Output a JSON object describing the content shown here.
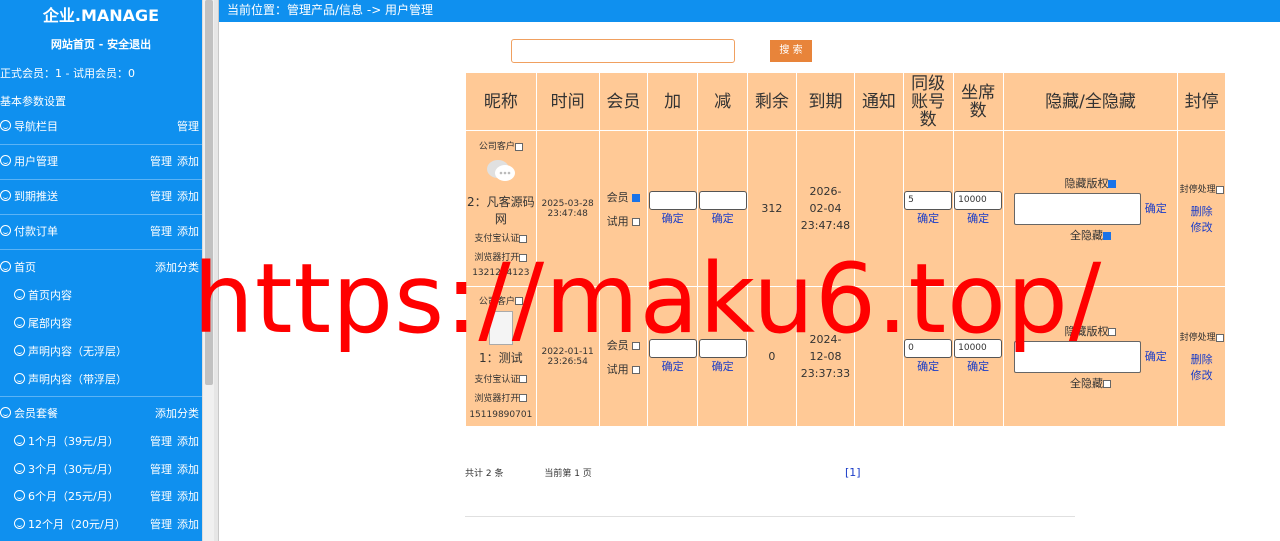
{
  "sidebar": {
    "title": "企业.MANAGE",
    "links": "网站首页  -  安全退出",
    "members": "正式会员：1  -  试用会员：0",
    "basic_settings": "基本参数设置",
    "rows": [
      {
        "label": "导航栏目",
        "a1": "",
        "a2": "管理"
      },
      {
        "label": "用户管理",
        "a1": "管理",
        "a2": "添加"
      },
      {
        "label": "到期推送",
        "a1": "管理",
        "a2": "添加"
      },
      {
        "label": "付款订单",
        "a1": "管理",
        "a2": "添加"
      }
    ],
    "home": {
      "label": "首页",
      "action": "添加分类"
    },
    "home_items": [
      "首页内容",
      "尾部内容",
      "声明内容（无浮层）",
      "声明内容（带浮层）"
    ],
    "package": {
      "label": "会员套餐",
      "action": "添加分类"
    },
    "package_items": [
      {
        "label": "1个月（39元/月）",
        "a1": "管理",
        "a2": "添加"
      },
      {
        "label": "3个月（30元/月）",
        "a1": "管理",
        "a2": "添加"
      },
      {
        "label": "6个月（25元/月）",
        "a1": "管理",
        "a2": "添加"
      },
      {
        "label": "12个月（20元/月）",
        "a1": "管理",
        "a2": "添加"
      }
    ]
  },
  "breadcrumb": "当前位置：管理产品/信息 -> 用户管理",
  "search": {
    "value": "",
    "button": "搜 索"
  },
  "table": {
    "headers": [
      "昵称",
      "时间",
      "会员",
      "加",
      "减",
      "剩余",
      "到期",
      "通知",
      "同级账号数",
      "坐席数",
      "隐藏/全隐藏",
      "封停"
    ],
    "rows": [
      {
        "company_label": "公司客户",
        "name": "2：凡客源码网",
        "alipay": "支付宝认证",
        "browser": "浏览器打开",
        "phone": "1321234123",
        "time_date": "2025-03-28",
        "time_clock": "23:47:48",
        "member": "会员",
        "trial": "试用",
        "confirm": "确定",
        "remaining": "312",
        "expire": "2026-02-04 23:47:48",
        "peer": "5",
        "seats": "10000",
        "hide_copyright": "隐藏版权",
        "hide_all": "全隐藏",
        "ban": "封停处理",
        "delete": "删除",
        "edit": "修改"
      },
      {
        "company_label": "公司客户",
        "name": "1：测试",
        "alipay": "支付宝认证",
        "browser": "浏览器打开",
        "phone": "15119890701",
        "time_date": "2022-01-11",
        "time_clock": "23:26:54",
        "member": "会员",
        "trial": "试用",
        "confirm": "确定",
        "remaining": "0",
        "expire": "2024-12-08 23:37:33",
        "peer": "0",
        "seats": "10000",
        "hide_copyright": "隐藏版权",
        "hide_all": "全隐藏",
        "ban": "封停处理",
        "delete": "删除",
        "edit": "修改"
      }
    ]
  },
  "footer": {
    "total": "共计 2 条",
    "current": "当前第 1 页",
    "page": "[1]"
  },
  "watermark": "https://maku6.top/"
}
